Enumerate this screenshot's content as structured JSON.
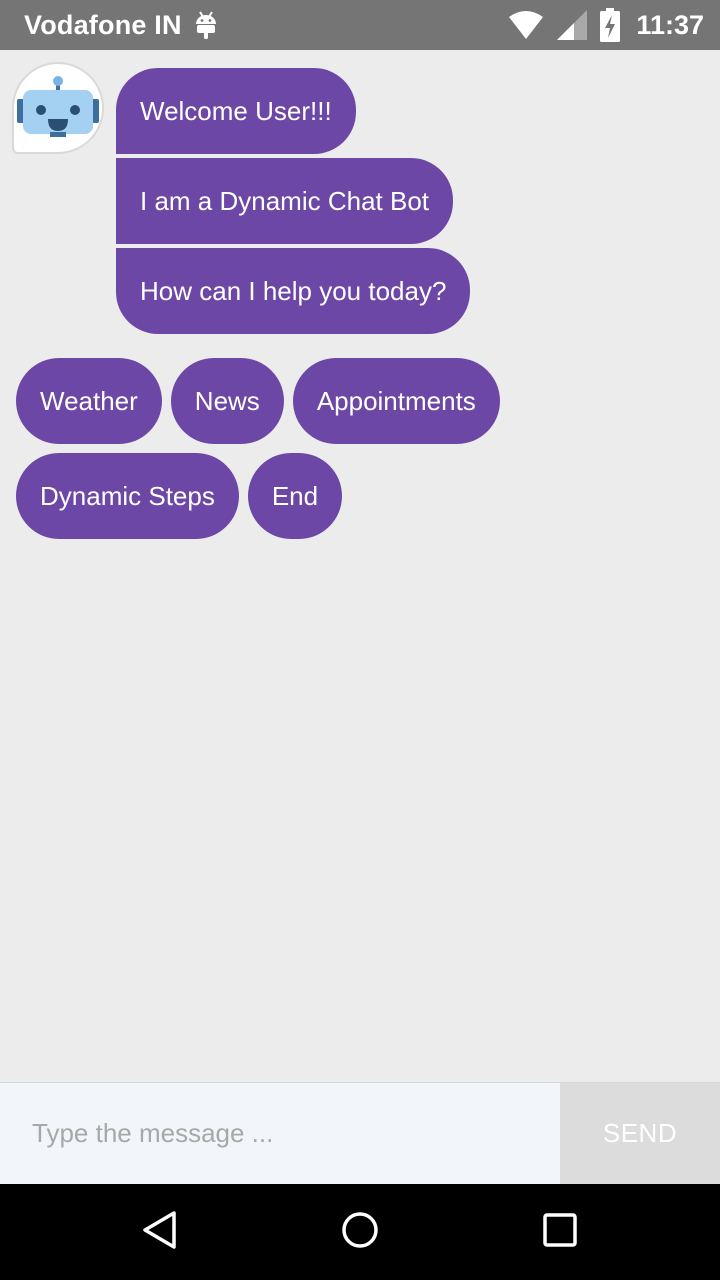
{
  "status_bar": {
    "carrier": "Vodafone IN",
    "time": "11:37",
    "icons": [
      "android-icon",
      "wifi-icon",
      "signal-icon",
      "battery-charging-icon"
    ]
  },
  "chat": {
    "bot_avatar": "robot-icon",
    "messages": [
      "Welcome User!!!",
      "I am a Dynamic Chat Bot",
      "How can I help you today?"
    ],
    "quick_replies": [
      "Weather",
      "News",
      "Appointments",
      "Dynamic Steps",
      "End"
    ]
  },
  "composer": {
    "placeholder": "Type the message ...",
    "value": "",
    "send_label": "SEND"
  },
  "nav_bar": {
    "icons": [
      "back-icon",
      "home-icon",
      "recents-icon"
    ]
  },
  "colors": {
    "bubble": "#6c47a6",
    "background": "#ececec",
    "status_bar": "#757575",
    "input_bg": "#f2f6fa",
    "send_bg": "#dcdcdc"
  }
}
